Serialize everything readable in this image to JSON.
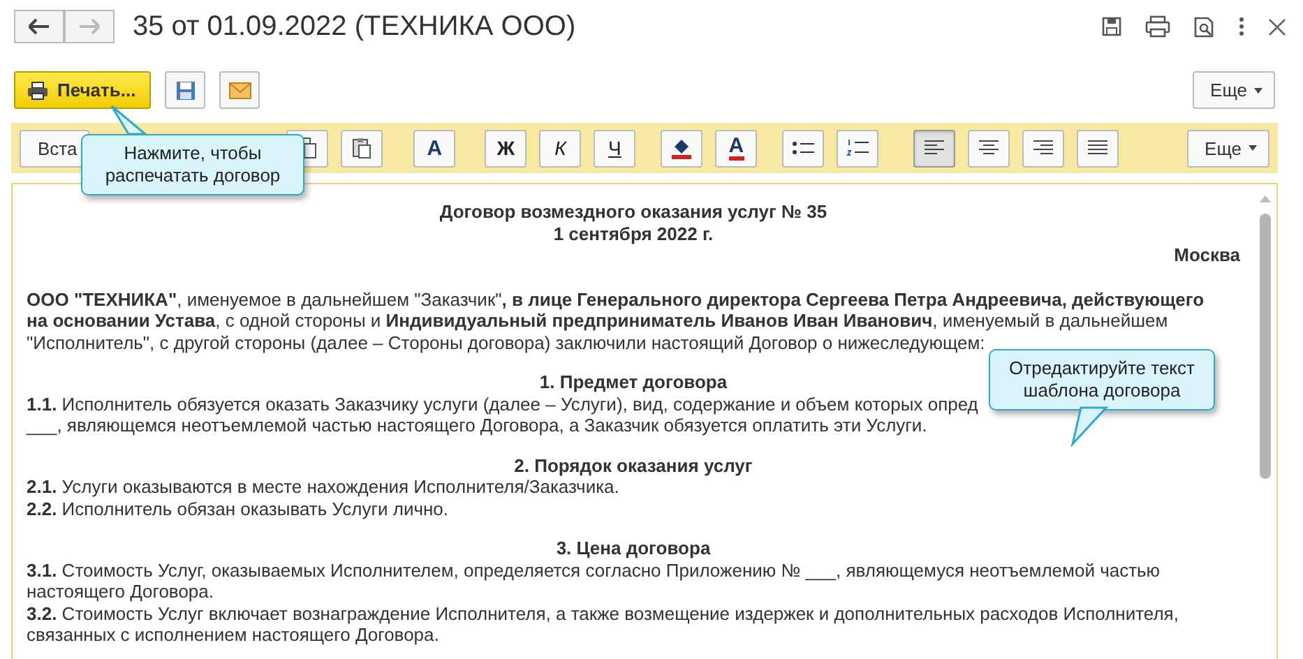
{
  "window": {
    "title": "35 от 01.09.2022 (ТЕХНИКА ООО)"
  },
  "command_bar": {
    "print_button": "Печать...",
    "more_button": "Еще"
  },
  "format_toolbar": {
    "groups": [
      [
        {
          "kind": "text",
          "label": "Вста",
          "selected": false
        }
      ],
      [
        {
          "kind": "copy",
          "selected": false
        },
        {
          "kind": "paste",
          "selected": false
        }
      ],
      [
        {
          "kind": "font",
          "label": "A",
          "selected": false
        }
      ],
      [
        {
          "kind": "bold",
          "label": "Ж",
          "selected": false
        },
        {
          "kind": "italic",
          "label": "К",
          "selected": false
        },
        {
          "kind": "underline",
          "label": "Ч",
          "selected": false
        }
      ],
      [
        {
          "kind": "fill-color",
          "selected": false
        },
        {
          "kind": "font-color",
          "label": "A",
          "selected": false
        }
      ],
      [
        {
          "kind": "bullets",
          "selected": false
        },
        {
          "kind": "numbering",
          "selected": false
        }
      ],
      [
        {
          "kind": "align-left",
          "selected": true
        },
        {
          "kind": "align-center",
          "selected": false
        },
        {
          "kind": "align-right",
          "selected": false
        },
        {
          "kind": "justify",
          "selected": false
        }
      ]
    ],
    "more_button": "Еще"
  },
  "document": {
    "title": "Договор возмездного оказания услуг № 35",
    "date": "1 сентября 2022 г.",
    "city": "Москва",
    "intro": "**ООО \"ТЕХНИКА\"**, именуемое в дальнейшем \"Заказчик\"**, в лице Генерального директора Сергеева Петра Андреевича, действующего на основании Устава**, с одной стороны и **Индивидуальный предприниматель Иванов Иван Иванович**, именуемый в дальнейшем \"Исполнитель\", с другой стороны (далее – Стороны договора) заключили настоящий Договор о нижеследующем:",
    "sections": [
      {
        "heading": "1. Предмет договора",
        "clauses": [
          {
            "number": "1.1.",
            "lines": [
              "Исполнитель обязуется оказать Заказчику услуги (далее – Услуги), вид, содержание и объем которых опред",
              "___, являющемся неотъемлемой частью настоящего Договора, а Заказчик обязуется оплатить эти Услуги."
            ]
          }
        ]
      },
      {
        "heading": "2. Порядок оказания услуг",
        "clauses": [
          {
            "number": "2.1.",
            "lines": [
              "Услуги оказываются в месте нахождения Исполнителя/Заказчика."
            ]
          },
          {
            "number": "2.2.",
            "lines": [
              "Исполнитель обязан оказывать Услуги лично."
            ]
          }
        ]
      },
      {
        "heading": "3. Цена договора",
        "clauses": [
          {
            "number": "3.1.",
            "text": "Стоимость Услуг, оказываемых Исполнителем, определяется согласно Приложению № ___, являющемуся неотъемлемой частью настоящего Договора."
          },
          {
            "number": "3.2.",
            "text": "Стоимость Услуг включает вознаграждение Исполнителя, а также возмещение издержек и дополнительных расходов Исполнителя, связанных с исполнением настоящего Договора."
          }
        ]
      }
    ]
  },
  "hints": [
    {
      "text": "Нажмите, чтобы распечатать договор"
    },
    {
      "text": "Отредактируйте текст шаблона договора"
    }
  ]
}
